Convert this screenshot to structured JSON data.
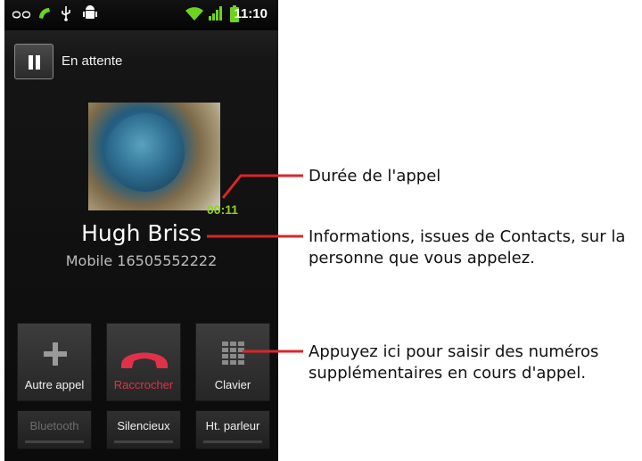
{
  "status_bar": {
    "time": "11:10",
    "icons": [
      "voicemail-icon",
      "phone-call-icon",
      "usb-icon",
      "android-debug-icon",
      "wifi-icon",
      "signal-icon",
      "battery-icon"
    ]
  },
  "call": {
    "hold_label": "En attente",
    "caller_name": "Hugh Briss",
    "caller_number": "Mobile 16505552222",
    "timer": "00:11"
  },
  "buttons": {
    "add_call": "Autre appel",
    "end_call": "Raccrocher",
    "keypad": "Clavier",
    "bluetooth": "Bluetooth",
    "mute": "Silencieux",
    "speaker": "Ht. parleur"
  },
  "annotations": {
    "duration": "Durée de l'appel",
    "info_line1": "Informations, issues de Contacts, sur la",
    "info_line2": "personne que vous appelez.",
    "keypad_line1": "Appuyez ici pour saisir des numéros",
    "keypad_line2": "supplémentaires en cours d'appel."
  },
  "colors": {
    "timer": "#8fd126",
    "end_call": "#e0314b",
    "callout": "#d9262b"
  }
}
